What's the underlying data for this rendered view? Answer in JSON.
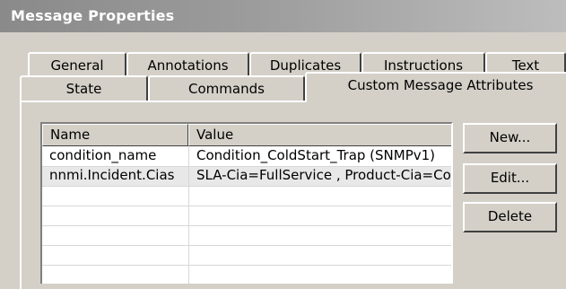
{
  "window": {
    "title": "Message Properties"
  },
  "tabs": {
    "row1": [
      "General",
      "Annotations",
      "Duplicates",
      "Instructions",
      "Text"
    ],
    "row2": [
      "State",
      "Commands",
      "Custom Message Attributes"
    ],
    "active": "Custom Message Attributes"
  },
  "attributes_table": {
    "columns": [
      "Name",
      "Value"
    ],
    "rows": [
      {
        "name": "condition_name",
        "value": "Condition_ColdStart_Trap (SNMPv1)"
      },
      {
        "name": "nnmi.Incident.Cias",
        "value": "SLA-Cia=FullService , Product-Cia=Co"
      }
    ]
  },
  "buttons": {
    "new": "New...",
    "edit": "Edit...",
    "delete": "Delete"
  }
}
